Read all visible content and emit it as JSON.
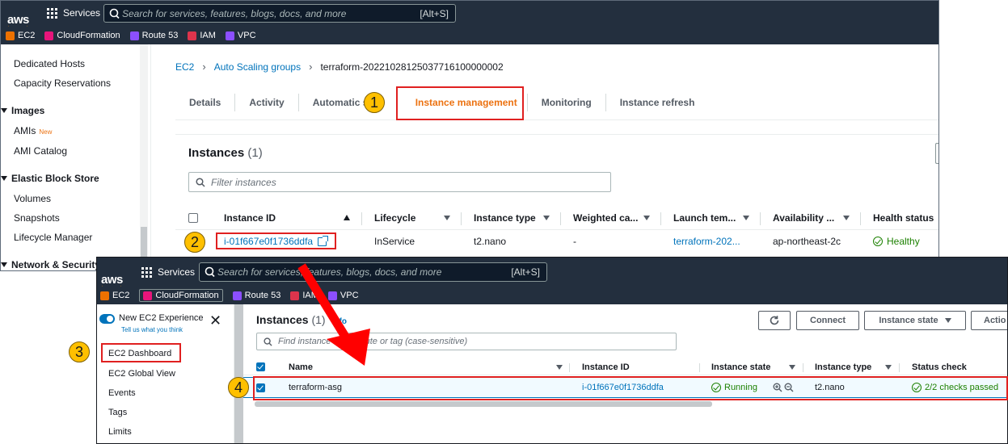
{
  "window1": {
    "topbar": {
      "services_label": "Services",
      "search_placeholder": "Search for services, features, blogs, docs, and more",
      "search_shortcut": "[Alt+S]",
      "logo": "aws"
    },
    "favorites": [
      {
        "label": "EC2",
        "color": "#ed7100"
      },
      {
        "label": "CloudFormation",
        "color": "#e7157b"
      },
      {
        "label": "Route 53",
        "color": "#8c4fff"
      },
      {
        "label": "IAM",
        "color": "#dd344c"
      },
      {
        "label": "VPC",
        "color": "#8c4fff"
      }
    ],
    "sidebar": {
      "items": [
        "Dedicated Hosts",
        "Capacity Reservations"
      ],
      "images_heading": "Images",
      "images_items": [
        "AMIs",
        "AMI Catalog"
      ],
      "new_badge": "New",
      "ebs_heading": "Elastic Block Store",
      "ebs_items": [
        "Volumes",
        "Snapshots",
        "Lifecycle Manager"
      ],
      "network_heading": "Network & Security"
    },
    "breadcrumb": [
      "EC2",
      "Auto Scaling groups",
      "terraform-20221028125037716100000002"
    ],
    "tabs": [
      "Details",
      "Activity",
      "Automatic sc",
      "Instance management",
      "Monitoring",
      "Instance refresh"
    ],
    "panel": {
      "title": "Instances",
      "count": "(1)",
      "filter_placeholder": "Filter instances",
      "columns": [
        "Instance ID",
        "Lifecycle",
        "Instance type",
        "Weighted ca...",
        "Launch tem...",
        "Availability ...",
        "Health status"
      ],
      "row": {
        "instance_id": "i-01f667e0f1736ddfa",
        "lifecycle": "InService",
        "instance_type": "t2.nano",
        "weighted": "-",
        "launch_template": "terraform-202...",
        "availability": "ap-northeast-2c",
        "health": "Healthy"
      }
    }
  },
  "window2": {
    "topbar": {
      "services_label": "Services",
      "search_placeholder": "Search for services, features, blogs, docs, and more",
      "search_shortcut": "[Alt+S]",
      "logo": "aws"
    },
    "favorites": [
      {
        "label": "EC2",
        "color": "#ed7100"
      },
      {
        "label": "CloudFormation",
        "color": "#e7157b"
      },
      {
        "label": "Route 53",
        "color": "#8c4fff"
      },
      {
        "label": "IAM",
        "color": "#dd344c"
      },
      {
        "label": "VPC",
        "color": "#8c4fff"
      }
    ],
    "sidebar": {
      "new_experience": "New EC2 Experience",
      "tell_us": "Tell us what you think",
      "items": [
        "EC2 Dashboard",
        "EC2 Global View",
        "Events",
        "Tags",
        "Limits"
      ]
    },
    "main": {
      "title": "Instances",
      "count": "(1)",
      "info": "Info",
      "buttons": {
        "connect": "Connect",
        "instance_state": "Instance state",
        "actions": "Actio"
      },
      "filter_placeholder": "Find instance by attribute or tag (case-sensitive)",
      "columns": [
        "Name",
        "Instance ID",
        "Instance state",
        "Instance type",
        "Status check"
      ],
      "row": {
        "name": "terraform-asg",
        "instance_id": "i-01f667e0f1736ddfa",
        "state": "Running",
        "instance_type": "t2.nano",
        "status_check": "2/2 checks passed"
      }
    }
  },
  "annotations": {
    "steps": [
      "1",
      "2",
      "3",
      "4"
    ],
    "highlight_color": "#e02020",
    "badge_color": "#ffc000",
    "arrow_color": "#ff0000"
  }
}
